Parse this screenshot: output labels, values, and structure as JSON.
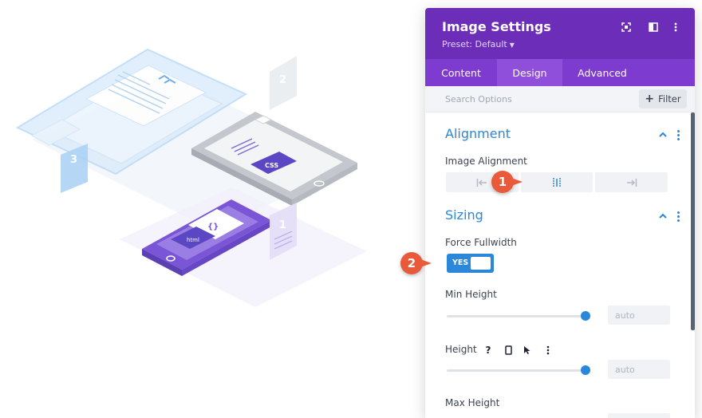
{
  "illustration": {
    "card_labels": [
      "2",
      "3",
      "1"
    ],
    "code_labels": [
      "CSS",
      "html",
      "{}"
    ]
  },
  "panel": {
    "title": "Image Settings",
    "preset": "Preset: Default",
    "header_icons": [
      "focus-icon",
      "split-view-icon",
      "more-vertical-icon"
    ],
    "tabs": [
      {
        "label": "Content",
        "active": false
      },
      {
        "label": "Design",
        "active": true
      },
      {
        "label": "Advanced",
        "active": false
      }
    ],
    "search_placeholder": "Search Options",
    "filter_label": "Filter",
    "sections": {
      "alignment": {
        "title": "Alignment",
        "image_alignment_label": "Image Alignment",
        "options": [
          "left",
          "center",
          "right"
        ],
        "selected": "center"
      },
      "sizing": {
        "title": "Sizing",
        "force_fullwidth_label": "Force Fullwidth",
        "force_fullwidth_value": "YES",
        "min_height_label": "Min Height",
        "min_height_value": "auto",
        "height_label": "Height",
        "height_value": "auto",
        "max_height_label": "Max Height"
      }
    }
  },
  "badges": [
    "1",
    "2"
  ],
  "colors": {
    "header": "#6c2eb9",
    "tabs": "#7e3bd0",
    "accent": "#2b87da",
    "badge": "#e85a3a"
  }
}
